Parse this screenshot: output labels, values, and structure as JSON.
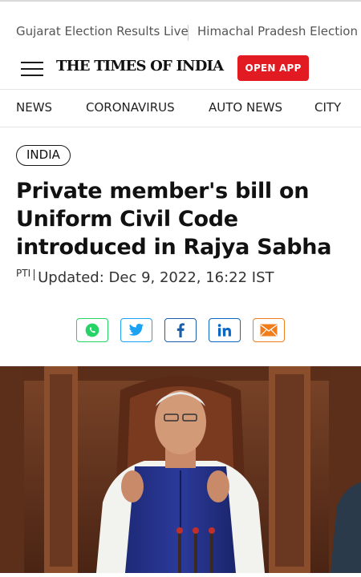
{
  "trending": {
    "items": [
      "Gujarat Election Results Live",
      "Himachal Pradesh Election R"
    ]
  },
  "header": {
    "logo_text": "THE TIMES OF INDIA",
    "open_app_label": "OPEN APP",
    "brand_color": "#e21b22"
  },
  "nav": {
    "items": [
      "NEWS",
      "CORONAVIRUS",
      "AUTO NEWS",
      "CITY"
    ]
  },
  "article": {
    "category": "INDIA",
    "headline": "Private member's bill on Uniform Civil Code introduced in Rajya Sabha",
    "source": "PTI",
    "updated": "Updated: Dec 9, 2022, 16:22 IST"
  },
  "share": {
    "buttons": [
      {
        "icon": "whatsapp-icon",
        "color": "#25d366"
      },
      {
        "icon": "twitter-icon",
        "color": "#1da1f2"
      },
      {
        "icon": "facebook-icon",
        "color": "#1a5da8"
      },
      {
        "icon": "linkedin-icon",
        "color": "#0a66c2"
      },
      {
        "icon": "email-icon",
        "color": "#f07d19"
      }
    ]
  }
}
